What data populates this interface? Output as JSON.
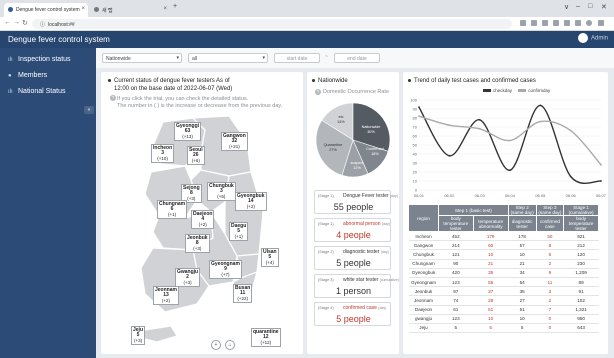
{
  "browser": {
    "tab1": "Dengue fever control system",
    "tab2": "새 탭",
    "new_tab": "+",
    "url": "localhost:##",
    "window_controls": [
      "∨",
      "–",
      "□",
      "✕"
    ]
  },
  "app": {
    "title": "Dengue fever control system",
    "user": "Admin"
  },
  "sidebar": {
    "items": [
      {
        "label": "Inspection status",
        "icon": "bar-chart-icon"
      },
      {
        "label": "Members",
        "icon": "users-icon"
      },
      {
        "label": "National Status",
        "icon": "bar-chart-icon"
      }
    ],
    "collapse": "«"
  },
  "filters": {
    "region": "Nationwide",
    "scope": "all",
    "start_date": "start date",
    "end_date": "end date",
    "separator": "~"
  },
  "map_panel": {
    "title_line1": "Current status of dengue fever testers As of",
    "title_line2": "12:00 on the base date of 2022-06-07 (Wed)",
    "hint_line1": "If you click the trial, you can check the detailed status.",
    "hint_line2": "The number in ( ) is the increase or decrease from the previous day.",
    "regions": [
      {
        "name": "Gyeonggi",
        "value": "63",
        "delta": "(+13)"
      },
      {
        "name": "Gangwon",
        "value": "32",
        "delta": "(+21)"
      },
      {
        "name": "Incheon",
        "value": "3",
        "delta": "(+10)"
      },
      {
        "name": "Seoul",
        "value": "26",
        "delta": "(+6)"
      },
      {
        "name": "Sejong",
        "value": "8",
        "delta": "(+3)"
      },
      {
        "name": "Chungbuk",
        "value": "3",
        "delta": "(+5)"
      },
      {
        "name": "Gyeongbuk",
        "value": "14",
        "delta": "(+2)"
      },
      {
        "name": "Chungnam",
        "value": "6",
        "delta": "(+1)"
      },
      {
        "name": "Daejeon",
        "value": "4",
        "delta": "(+2)"
      },
      {
        "name": "Jeonbuk",
        "value": "8",
        "delta": "(+3)"
      },
      {
        "name": "Daegu",
        "value": "5",
        "delta": "(+1)"
      },
      {
        "name": "Ulsan",
        "value": "5",
        "delta": "(+4)"
      },
      {
        "name": "Gwangju",
        "value": "2",
        "delta": "(+3)"
      },
      {
        "name": "Gyeongnam",
        "value": "9",
        "delta": "(+7)"
      },
      {
        "name": "Jeonnam",
        "value": "13",
        "delta": "(+2)"
      },
      {
        "name": "Busan",
        "value": "11",
        "delta": "(+22)"
      },
      {
        "name": "Jeju",
        "value": "5",
        "delta": "(+3)"
      },
      {
        "name": "quarantine",
        "value": "12",
        "delta": "(+12)"
      }
    ]
  },
  "nationwide_panel": {
    "title": "Nationwide",
    "subtitle": "Domestic Occurrence Rate",
    "pie_labels": [
      {
        "name": "etc",
        "pct": "14%"
      },
      {
        "name": "Nationwide",
        "pct": "30%"
      },
      {
        "name": "Confirmed",
        "pct": "18%"
      },
      {
        "name": "suspect",
        "pct": "12%"
      },
      {
        "name": "Quarantine",
        "pct": "27%"
      }
    ],
    "stages": [
      {
        "stage": "(Stage 1)",
        "name": "Dengue Fever tester",
        "suffix": "(day)",
        "value": "55 people",
        "red": false
      },
      {
        "stage": "(Stage 1)",
        "name": "abnormal person",
        "suffix": "(day)",
        "value": "4 people",
        "red": true
      },
      {
        "stage": "(Stage 2)",
        "name": "diagnostic tester",
        "suffix": "(day)",
        "value": "5 people",
        "red": false
      },
      {
        "stage": "(Stage 3)",
        "name": "white star tester",
        "suffix": "(cumulative)",
        "value": "1 person",
        "red": false
      },
      {
        "stage": "(Stage 4)",
        "name": "confirmed case",
        "suffix": "(day)",
        "value": "5 people",
        "red": true
      }
    ]
  },
  "trend_panel": {
    "title": "Trend of daily test cases and confirmed cases",
    "legend": [
      "checkday",
      "confirmday"
    ]
  },
  "chart_data": {
    "type": "line",
    "x": [
      "06.01",
      "06.02",
      "06.03",
      "06.04",
      "06.05",
      "06.06",
      "06.07"
    ],
    "series": [
      {
        "name": "checkday",
        "values": [
          92,
          38,
          78,
          22,
          94,
          15,
          10
        ]
      },
      {
        "name": "confirmday",
        "values": [
          82,
          72,
          68,
          55,
          76,
          66,
          28
        ]
      }
    ],
    "yticks": [
      0,
      10,
      20,
      30,
      40,
      50,
      60,
      70,
      80,
      90,
      100
    ],
    "ylim": [
      0,
      100
    ],
    "colors": {
      "checkday": "#333333",
      "confirmday": "#aaaaaa"
    }
  },
  "table": {
    "group_headers": [
      "Step 1 (basic test)",
      "Step 2 (same day)",
      "Step 3 (same day)",
      "Stage 1 (cumulative)"
    ],
    "region_header": "region",
    "sub_headers": [
      "body temperature tester",
      "temperature abnormality",
      "diagnostic tester",
      "confirmed case",
      "body temperature tester"
    ],
    "rows": [
      [
        "Incheon",
        "452",
        "179",
        "178",
        "50",
        "921"
      ],
      [
        "Gangwon",
        "214",
        "60",
        "57",
        "8",
        "212"
      ],
      [
        "Chungbuk",
        "121",
        "10",
        "10",
        "6",
        "120"
      ],
      [
        "Chungnam",
        "90",
        "21",
        "21",
        "2",
        "230"
      ],
      [
        "Gyeongbuk",
        "420",
        "35",
        "34",
        "9",
        "1,209"
      ],
      [
        "Gyeongnam",
        "123",
        "55",
        "54",
        "11",
        "89"
      ],
      [
        "Jeonbuk",
        "97",
        "37",
        "35",
        "3",
        "91"
      ],
      [
        "Jeonnam",
        "74",
        "28",
        "27",
        "2",
        "102"
      ],
      [
        "Daejeon",
        "61",
        "51",
        "51",
        "7",
        "1,321"
      ],
      [
        "gwangju",
        "123",
        "10",
        "10",
        "0",
        "950"
      ],
      [
        "Jeju",
        "5",
        "5",
        "5",
        "0",
        "643"
      ]
    ]
  }
}
